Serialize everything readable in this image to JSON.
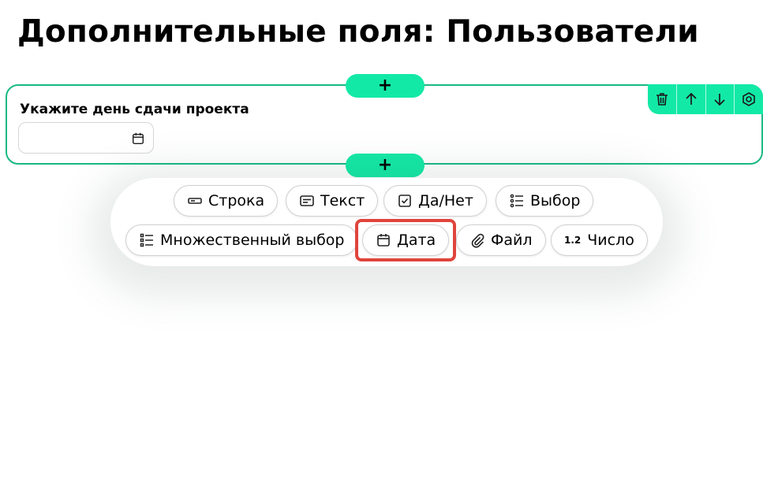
{
  "page": {
    "title": "Дополнительные поля: Пользователи"
  },
  "field": {
    "label": "Укажите день сдачи проекта",
    "date_value": "",
    "toolbar": [
      "trash-icon",
      "arrow-up-icon",
      "arrow-down-icon",
      "settings-icon"
    ]
  },
  "add_button": {
    "label": "+"
  },
  "palette": {
    "row1": [
      {
        "name": "chip-string",
        "icon": "string-field-icon",
        "label": "Строка"
      },
      {
        "name": "chip-text",
        "icon": "text-field-icon",
        "label": "Текст"
      },
      {
        "name": "chip-yes-no",
        "icon": "checkbox-icon",
        "label": "Да/Нет"
      },
      {
        "name": "chip-choice",
        "icon": "list-icon",
        "label": "Выбор"
      }
    ],
    "row2": [
      {
        "name": "chip-multi-choice",
        "icon": "multi-list-icon",
        "label": "Множественный выбор"
      },
      {
        "name": "chip-date",
        "icon": "calendar-icon",
        "label": "Дата"
      },
      {
        "name": "chip-file",
        "icon": "paperclip-icon",
        "label": "Файл"
      },
      {
        "name": "chip-number",
        "icon": "number-icon",
        "icon_glyph": "1.2",
        "label": "Число"
      }
    ]
  },
  "colors": {
    "accent": "#13e9a6",
    "border": "#19b885",
    "highlight": "#e0443c"
  }
}
